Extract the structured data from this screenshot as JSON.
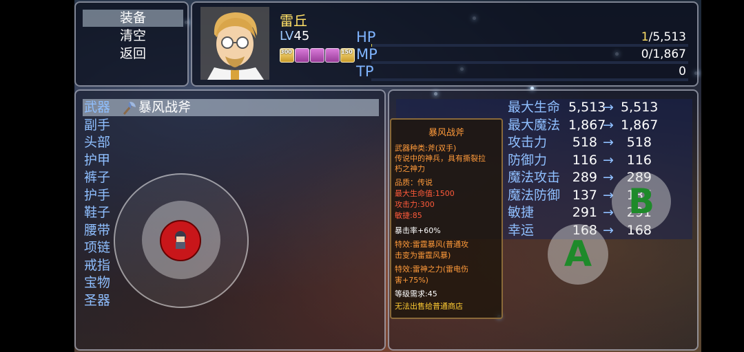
{
  "command_menu": {
    "items": [
      {
        "label": "装备",
        "selected": true
      },
      {
        "label": "清空",
        "selected": false
      },
      {
        "label": "返回",
        "selected": false
      }
    ]
  },
  "actor": {
    "name": "雷丘",
    "level_prefix": "LV",
    "level": "45",
    "states": [
      {
        "icon": "buff-300-icon",
        "text": "300"
      },
      {
        "icon": "buff-knife-icon",
        "text": ""
      },
      {
        "icon": "buff-strength-icon",
        "text": ""
      },
      {
        "icon": "buff-potion-icon",
        "text": ""
      },
      {
        "icon": "buff-150-icon",
        "text": "150"
      }
    ],
    "hp": {
      "label": "HP",
      "current": "1",
      "max": "/5,513",
      "fraction": 0.0002
    },
    "mp": {
      "label": "MP",
      "text": "0/1,867",
      "fraction": 0
    },
    "tp": {
      "label": "TP",
      "text": "0",
      "fraction": 0
    }
  },
  "slots": {
    "items": [
      "武器",
      "副手",
      "头部",
      "护甲",
      "裤子",
      "护手",
      "鞋子",
      "腰带",
      "项链",
      "戒指",
      "宝物",
      "圣器"
    ],
    "equipped_weapon": "暴风战斧",
    "weapon_icon": "axe-icon"
  },
  "stats": [
    {
      "name": "最大生命",
      "old": "5,513",
      "new": "5,513"
    },
    {
      "name": "最大魔法",
      "old": "1,867",
      "new": "1,867"
    },
    {
      "name": "攻击力",
      "old": "518",
      "new": "518"
    },
    {
      "name": "防御力",
      "old": "116",
      "new": "116"
    },
    {
      "name": "魔法攻击",
      "old": "289",
      "new": "289"
    },
    {
      "name": "魔法防御",
      "old": "137",
      "new": "137"
    },
    {
      "name": "敏捷",
      "old": "291",
      "new": "291"
    },
    {
      "name": "幸运",
      "old": "168",
      "new": "168"
    }
  ],
  "arrow": "→",
  "tooltip": {
    "title": "暴风战斧",
    "lines": [
      {
        "text": "武器种类:斧(双手)",
        "color": "orange"
      },
      {
        "text": "传说中的神兵，具有撕裂拉",
        "color": "orange"
      },
      {
        "text": "朽之神力",
        "color": "orange"
      },
      {
        "text": "品质：传说",
        "color": "orange"
      },
      {
        "text": "最大生命值:1500",
        "color": "red"
      },
      {
        "text": "攻击力:300",
        "color": "red"
      },
      {
        "text": "敏捷:85",
        "color": "red"
      },
      {
        "text": "暴击率+60%",
        "color": "white"
      },
      {
        "text": "特效:雷霆暴风(普通攻",
        "color": "orange"
      },
      {
        "text": "击变为雷霆风暴)",
        "color": "orange"
      },
      {
        "text": "特效:雷神之力(雷电伤",
        "color": "orange"
      },
      {
        "text": "害+75%)",
        "color": "orange"
      },
      {
        "text": "等级需求:45",
        "color": "white"
      },
      {
        "text": "无法出售给普通商店",
        "color": "yellow"
      }
    ]
  },
  "buttons": {
    "a": "A",
    "b": "B"
  },
  "colors": {
    "hp": "#e8d84a",
    "mp": "#3a7fff",
    "accent_blue": "#8fbfff",
    "name_yellow": "#ffe067"
  }
}
